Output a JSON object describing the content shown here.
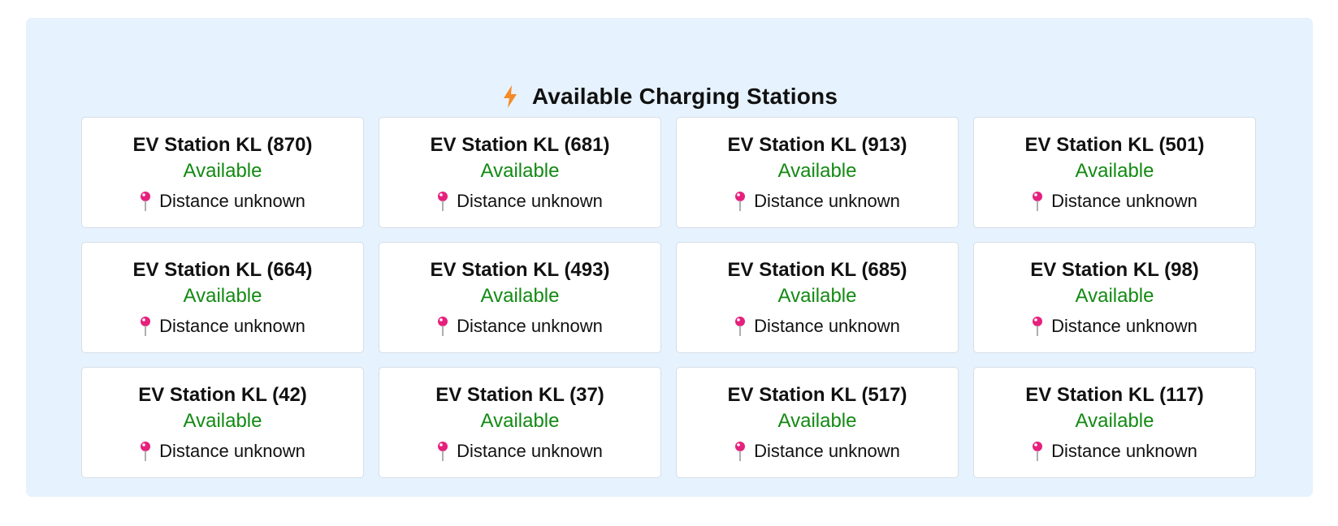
{
  "header": {
    "title": "Available Charging Stations",
    "icon": "lightning-bolt-icon"
  },
  "colors": {
    "panel_background": "#e6f2fd",
    "status_available": "#138a13",
    "bolt": "#f58a27",
    "pin": "#e6207d"
  },
  "stations": [
    {
      "name": "EV Station KL (870)",
      "status": "Available",
      "distance": "Distance unknown"
    },
    {
      "name": "EV Station KL (681)",
      "status": "Available",
      "distance": "Distance unknown"
    },
    {
      "name": "EV Station KL (913)",
      "status": "Available",
      "distance": "Distance unknown"
    },
    {
      "name": "EV Station KL (501)",
      "status": "Available",
      "distance": "Distance unknown"
    },
    {
      "name": "EV Station KL (664)",
      "status": "Available",
      "distance": "Distance unknown"
    },
    {
      "name": "EV Station KL (493)",
      "status": "Available",
      "distance": "Distance unknown"
    },
    {
      "name": "EV Station KL (685)",
      "status": "Available",
      "distance": "Distance unknown"
    },
    {
      "name": "EV Station KL (98)",
      "status": "Available",
      "distance": "Distance unknown"
    },
    {
      "name": "EV Station KL (42)",
      "status": "Available",
      "distance": "Distance unknown"
    },
    {
      "name": "EV Station KL (37)",
      "status": "Available",
      "distance": "Distance unknown"
    },
    {
      "name": "EV Station KL (517)",
      "status": "Available",
      "distance": "Distance unknown"
    },
    {
      "name": "EV Station KL (117)",
      "status": "Available",
      "distance": "Distance unknown"
    }
  ]
}
